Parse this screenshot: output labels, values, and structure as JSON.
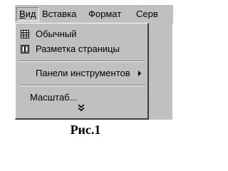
{
  "menubar": {
    "items": [
      {
        "label": "Вид",
        "underline": "В"
      },
      {
        "label": "Вставка"
      },
      {
        "label": "Формат"
      },
      {
        "label": "Серв"
      }
    ]
  },
  "view_menu": {
    "items": [
      {
        "label": "Обычный",
        "icon": "normal-view-icon"
      },
      {
        "label": "Разметка страницы",
        "icon": "page-layout-icon"
      },
      {
        "label": "Панели инструментов",
        "has_submenu": true
      },
      {
        "label": "Масштаб..."
      }
    ],
    "expand_glyph": "»"
  },
  "caption": "Рис.1"
}
